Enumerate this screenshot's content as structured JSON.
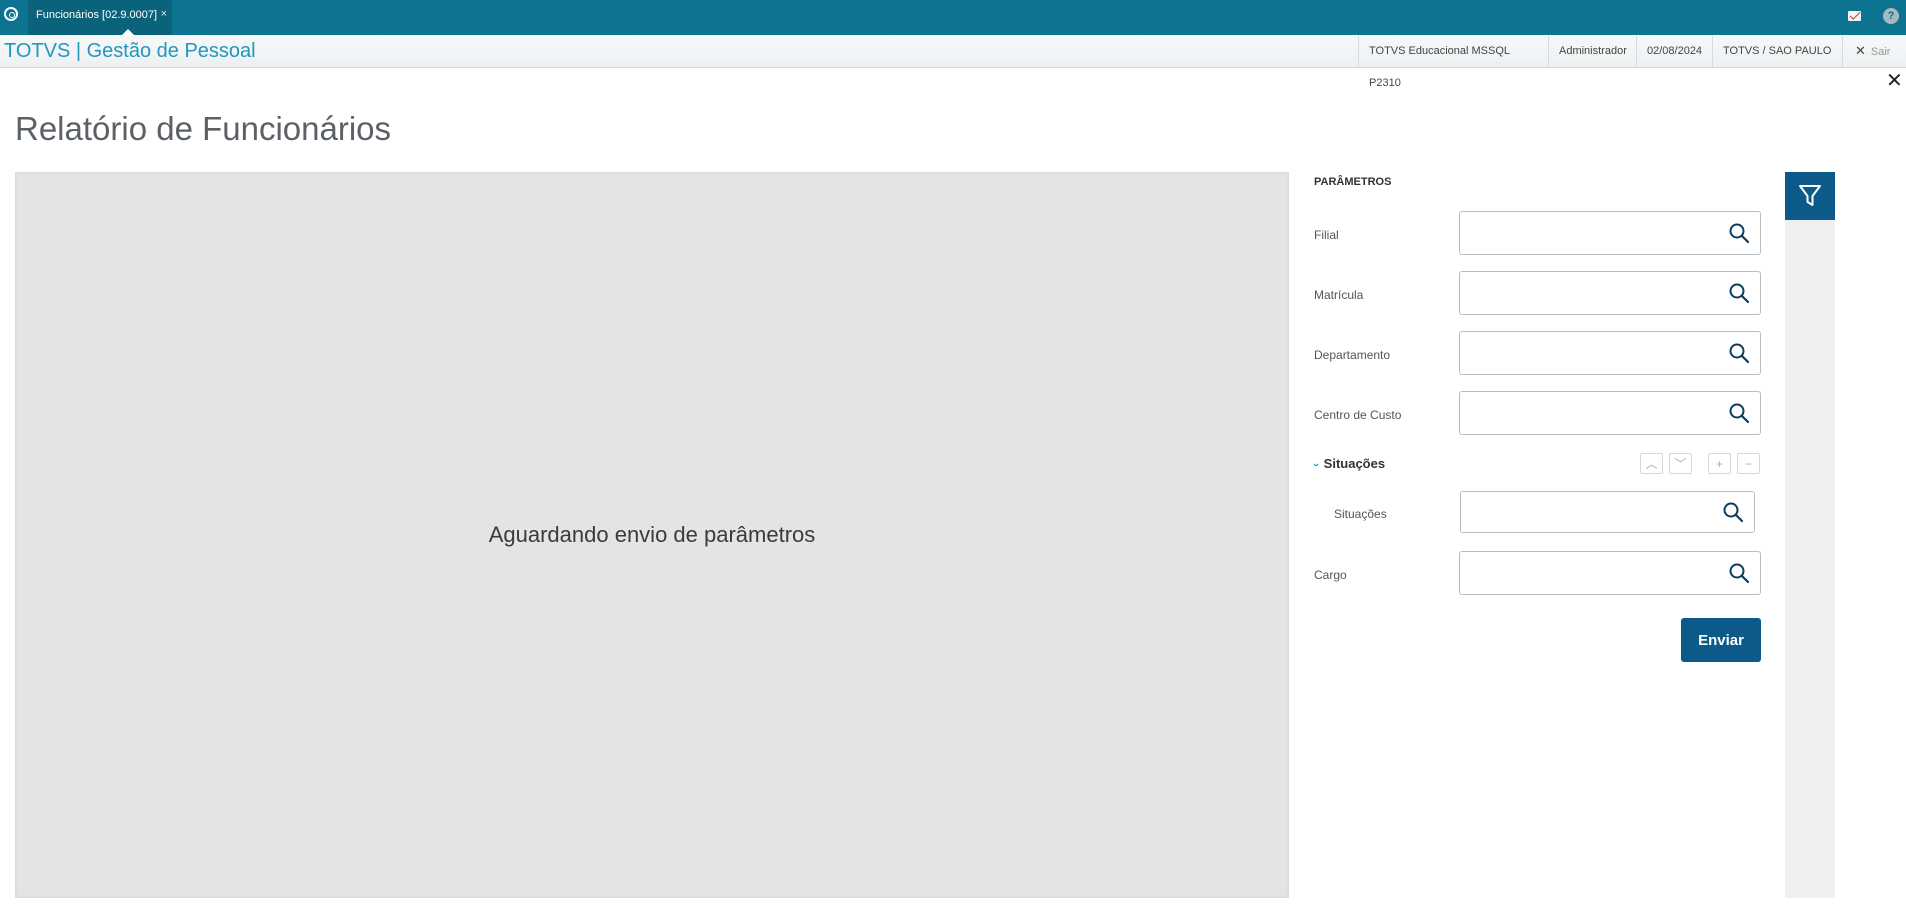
{
  "topbar": {
    "tab_label": "Funcionários [02.9.0007]",
    "tab_close": "×",
    "help_glyph": "?"
  },
  "header": {
    "brand": "TOTVS | Gestão de Pessoal",
    "context": "TOTVS Educacional MSSQL P2310",
    "user": "Administrador",
    "date": "02/08/2024",
    "branch": "TOTVS / SAO PAULO",
    "exit_label": "Sair"
  },
  "page": {
    "title": "Relatório de Funcionários",
    "close_glyph": "✕"
  },
  "preview": {
    "message": "Aguardando envio de parâmetros"
  },
  "params": {
    "title": "PARÂMETROS",
    "fields": [
      {
        "label": "Filial",
        "value": ""
      },
      {
        "label": "Matrícula",
        "value": ""
      },
      {
        "label": "Departamento",
        "value": ""
      },
      {
        "label": "Centro de Custo",
        "value": ""
      }
    ],
    "group": {
      "label": "Situações",
      "field_label": "Situações",
      "value": ""
    },
    "cargo": {
      "label": "Cargo",
      "value": ""
    },
    "submit_label": "Enviar"
  },
  "icons": {
    "logo": "totvs-logo-icon",
    "mail": "mail-icon",
    "help": "help-icon",
    "search": "search-icon",
    "filter": "filter-icon"
  },
  "colors": {
    "topbar": "#0c7390",
    "brand": "#2297bd",
    "primary_button": "#0c5a8a",
    "preview_bg": "#e4e4e4"
  }
}
